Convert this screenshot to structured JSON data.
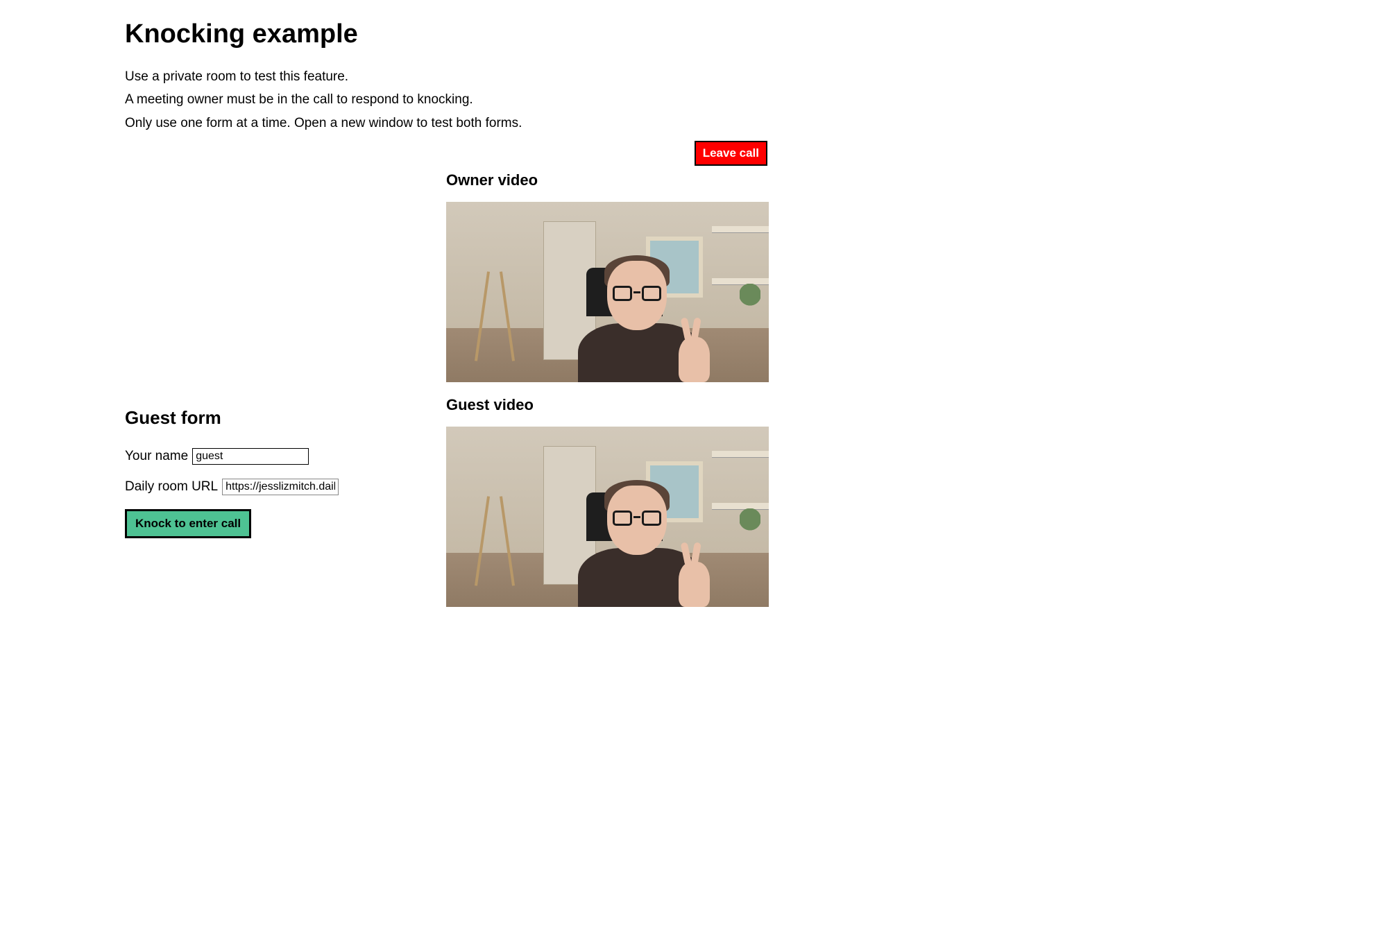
{
  "page": {
    "title": "Knocking example"
  },
  "intro": {
    "line1": "Use a private room to test this feature.",
    "line2": "A meeting owner must be in the call to respond to knocking.",
    "line3": "Only use one form at a time. Open a new window to test both forms."
  },
  "buttons": {
    "leave_call": "Leave call",
    "knock": "Knock to enter call"
  },
  "videos": {
    "owner_title": "Owner video",
    "guest_title": "Guest video"
  },
  "guest_form": {
    "heading": "Guest form",
    "name_label": "Your name",
    "name_value": "guest",
    "url_label": "Daily room URL",
    "url_value": "https://jesslizmitch.daily"
  }
}
